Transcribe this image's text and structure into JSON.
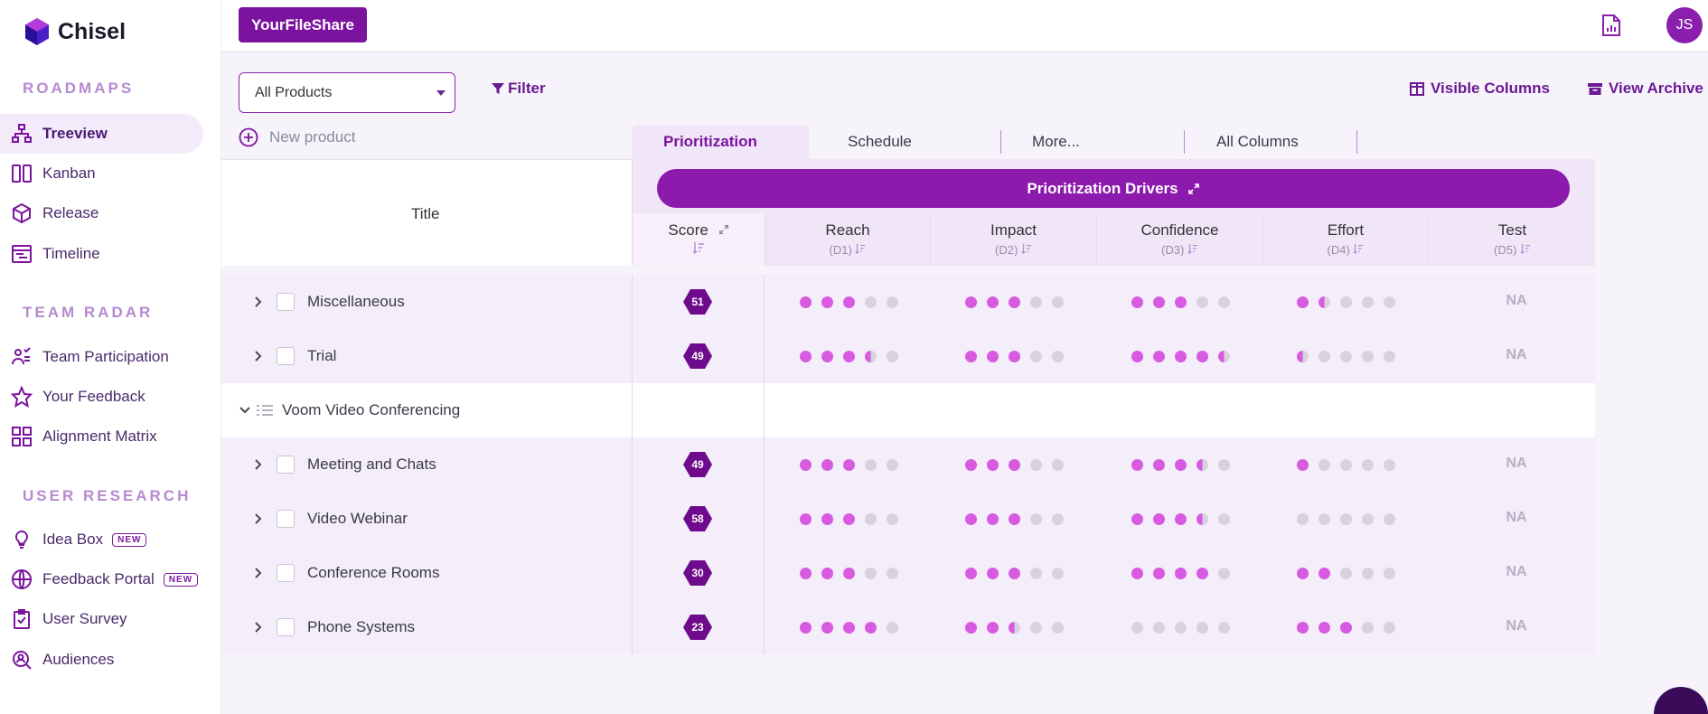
{
  "app": {
    "name": "Chisel"
  },
  "sidebar": {
    "sections": [
      {
        "title": "ROADMAPS",
        "items": [
          {
            "label": "Treeview",
            "icon": "treeview-icon",
            "active": true
          },
          {
            "label": "Kanban",
            "icon": "kanban-icon"
          },
          {
            "label": "Release",
            "icon": "release-icon"
          },
          {
            "label": "Timeline",
            "icon": "timeline-icon"
          }
        ]
      },
      {
        "title": "TEAM RADAR",
        "items": [
          {
            "label": "Team Participation",
            "icon": "team-icon"
          },
          {
            "label": "Your Feedback",
            "icon": "star-icon"
          },
          {
            "label": "Alignment Matrix",
            "icon": "grid-icon"
          }
        ]
      },
      {
        "title": "USER RESEARCH",
        "items": [
          {
            "label": "Idea Box",
            "icon": "lightbulb-icon",
            "badge": "NEW"
          },
          {
            "label": "Feedback Portal",
            "icon": "globe-icon",
            "badge": "NEW"
          },
          {
            "label": "User Survey",
            "icon": "clipboard-check-icon"
          },
          {
            "label": "Audiences",
            "icon": "search-user-icon"
          }
        ]
      }
    ]
  },
  "topbar": {
    "brand_button": "YourFileShare",
    "avatar_initials": "JS"
  },
  "toolbar": {
    "product_select": "All Products",
    "filter_label": "Filter",
    "visible_columns_label": "Visible Columns",
    "view_archive_label": "View Archive",
    "new_product_label": "New product"
  },
  "tabs": [
    "Prioritization",
    "Schedule",
    "More...",
    "All Columns"
  ],
  "table": {
    "title_header": "Title",
    "drivers_label": "Prioritization Drivers",
    "columns": [
      {
        "name": "Score",
        "sub": ""
      },
      {
        "name": "Reach",
        "sub": "(D1)"
      },
      {
        "name": "Impact",
        "sub": "(D2)"
      },
      {
        "name": "Confidence",
        "sub": "(D3)"
      },
      {
        "name": "Effort",
        "sub": "(D4)"
      },
      {
        "name": "Test",
        "sub": "(D5)"
      }
    ],
    "na_label": "NA",
    "colors": {
      "dot_on": "#d85ae0",
      "dot_off": "#d7d2de",
      "hex": "#6e0b8d"
    },
    "rows": [
      {
        "type": "item",
        "title": "Miscellaneous",
        "score": "51",
        "reach": 3,
        "impact": 3,
        "confidence": 3,
        "effort": 1.5,
        "test": "NA"
      },
      {
        "type": "item",
        "title": "Trial",
        "score": "49",
        "reach": 3.5,
        "impact": 3,
        "confidence": 4.5,
        "effort": 0.5,
        "test": "NA"
      },
      {
        "type": "group",
        "title": "Voom Video Conferencing"
      },
      {
        "type": "item",
        "title": "Meeting and Chats",
        "score": "49",
        "reach": 3,
        "impact": 3,
        "confidence": 3.5,
        "effort": 1,
        "test": "NA"
      },
      {
        "type": "item",
        "title": "Video Webinar",
        "score": "58",
        "reach": 3,
        "impact": 3,
        "confidence": 3.5,
        "effort": 0,
        "test": "NA"
      },
      {
        "type": "item",
        "title": "Conference Rooms",
        "score": "30",
        "reach": 3,
        "impact": 3,
        "confidence": 4,
        "effort": 2,
        "test": "NA"
      },
      {
        "type": "item",
        "title": "Phone Systems",
        "score": "23",
        "reach": 4,
        "impact": 2.5,
        "confidence": 0,
        "effort": 3,
        "test": "NA"
      }
    ]
  }
}
